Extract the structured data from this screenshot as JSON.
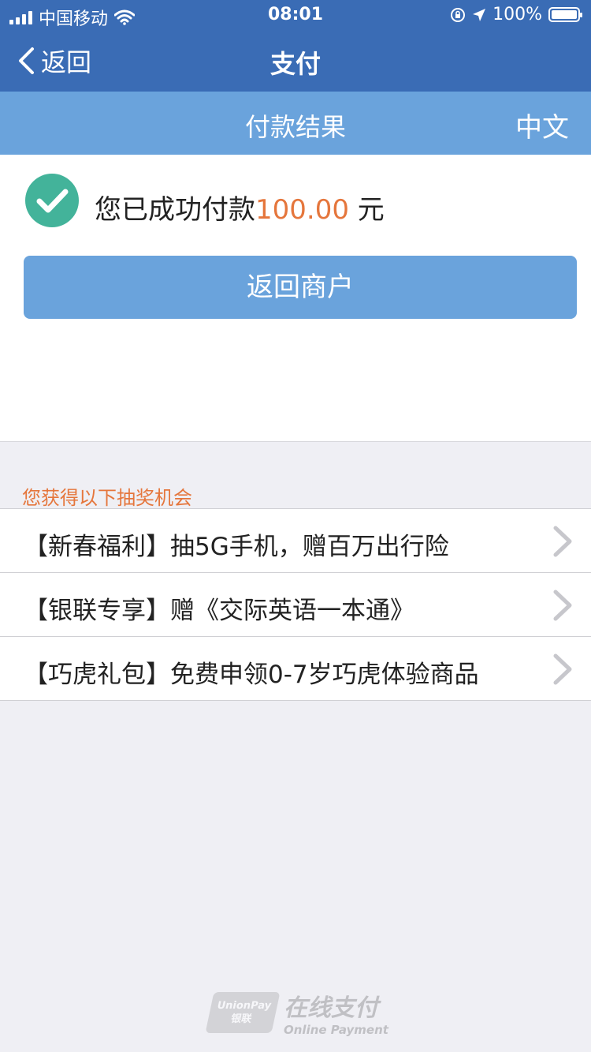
{
  "status_bar": {
    "carrier": "中国移动",
    "time": "08:01",
    "battery": "100%",
    "battery_level": 1.0
  },
  "nav": {
    "back_label": "返回",
    "title": "支付"
  },
  "subheader": {
    "title": "付款结果",
    "language": "中文"
  },
  "result": {
    "prefix": "您已成功付款",
    "amount": "100.00",
    "unit": " 元"
  },
  "merchant_button": "返回商户",
  "lottery": {
    "heading": "您获得以下抽奖机会",
    "items": [
      {
        "label": "【新春福利】抽5G手机，赠百万出行险"
      },
      {
        "label": "【银联专享】赠《交际英语一本通》"
      },
      {
        "label": "【巧虎礼包】免费申领0-7岁巧虎体验商品"
      }
    ]
  },
  "footer": {
    "logo_text": "UnionPay 银联",
    "cn": "在线支付",
    "en": "Online Payment"
  },
  "colors": {
    "nav_bg": "#3a6cb5",
    "accent_blue": "#6aa3dc",
    "success_green": "#43b39a",
    "amount_orange": "#e5763c"
  }
}
